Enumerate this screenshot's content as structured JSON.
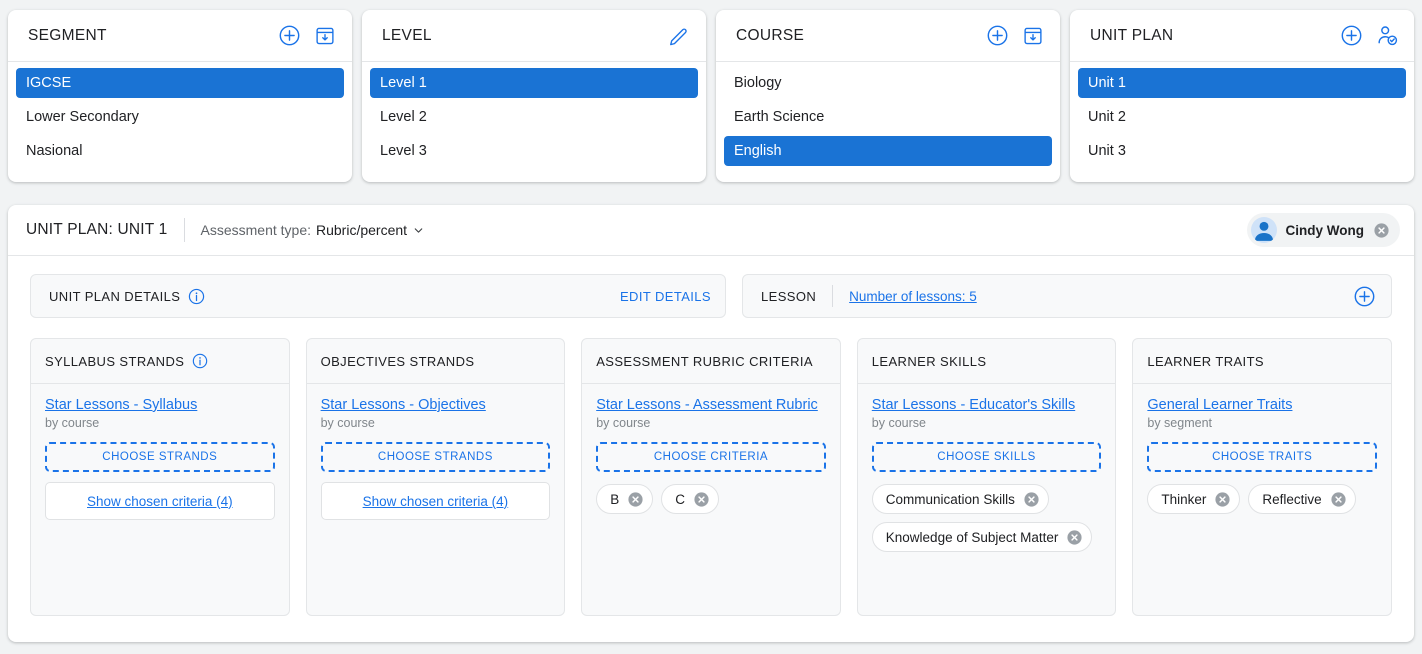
{
  "selectors": [
    {
      "title": "SEGMENT",
      "actions": [
        "add-icon",
        "archive-download-icon"
      ],
      "items": [
        {
          "label": "IGCSE",
          "selected": true
        },
        {
          "label": "Lower Secondary",
          "selected": false
        },
        {
          "label": "Nasional",
          "selected": false
        }
      ]
    },
    {
      "title": "LEVEL",
      "actions": [
        "edit-pencil-icon"
      ],
      "items": [
        {
          "label": "Level 1",
          "selected": true
        },
        {
          "label": "Level 2",
          "selected": false
        },
        {
          "label": "Level 3",
          "selected": false
        }
      ]
    },
    {
      "title": "COURSE",
      "actions": [
        "add-icon",
        "archive-download-icon"
      ],
      "items": [
        {
          "label": "Biology",
          "selected": false
        },
        {
          "label": "Earth Science",
          "selected": false
        },
        {
          "label": "English",
          "selected": true
        }
      ]
    },
    {
      "title": "UNIT PLAN",
      "actions": [
        "add-icon",
        "person-check-icon"
      ],
      "items": [
        {
          "label": "Unit 1",
          "selected": true
        },
        {
          "label": "Unit 2",
          "selected": false
        },
        {
          "label": "Unit 3",
          "selected": false
        }
      ]
    }
  ],
  "panel": {
    "title": "UNIT PLAN: UNIT 1",
    "assessment_label": "Assessment type:",
    "assessment_value": "Rubric/percent",
    "user": {
      "name": "Cindy Wong",
      "avatar_icon": "person-avatar-icon",
      "remove_icon": "close-circle-icon"
    }
  },
  "bars": {
    "unit_details_label": "UNIT PLAN DETAILS",
    "unit_details_info_icon": "info-icon",
    "edit_details_label": "EDIT DETAILS",
    "lesson_label": "LESSON",
    "lesson_link": "Number of lessons: 5",
    "lesson_add_icon": "add-icon"
  },
  "columns": [
    {
      "title": "SYLLABUS STRANDS",
      "has_info": true,
      "source_link": "Star Lessons - Syllabus",
      "source_by": "by course",
      "choose_label": "CHOOSE STRANDS",
      "show_label": "Show chosen criteria (4)",
      "chips": []
    },
    {
      "title": "OBJECTIVES STRANDS",
      "has_info": false,
      "source_link": "Star Lessons - Objectives",
      "source_by": "by course",
      "choose_label": "CHOOSE STRANDS",
      "show_label": "Show chosen criteria (4)",
      "chips": []
    },
    {
      "title": "ASSESSMENT RUBRIC CRITERIA",
      "has_info": false,
      "source_link": "Star Lessons - Assessment Rubric",
      "source_by": "by course",
      "choose_label": "CHOOSE CRITERIA",
      "show_label": null,
      "chips": [
        "B",
        "C"
      ]
    },
    {
      "title": "LEARNER SKILLS",
      "has_info": false,
      "source_link": "Star Lessons - Educator's Skills",
      "source_by": "by course",
      "choose_label": "CHOOSE SKILLS",
      "show_label": null,
      "chips": [
        "Communication Skills",
        "Knowledge of Subject Matter"
      ]
    },
    {
      "title": "LEARNER TRAITS",
      "has_info": false,
      "source_link": "General Learner Traits",
      "source_by": "by segment",
      "choose_label": "CHOOSE TRAITS",
      "show_label": null,
      "chips": [
        "Thinker",
        "Reflective"
      ]
    }
  ],
  "colors": {
    "accent": "#1a73e8",
    "selected_bg": "#1a73d4",
    "page_bg": "#f1f3f4",
    "panel_bg": "#ffffff",
    "muted_text": "#80868b"
  }
}
